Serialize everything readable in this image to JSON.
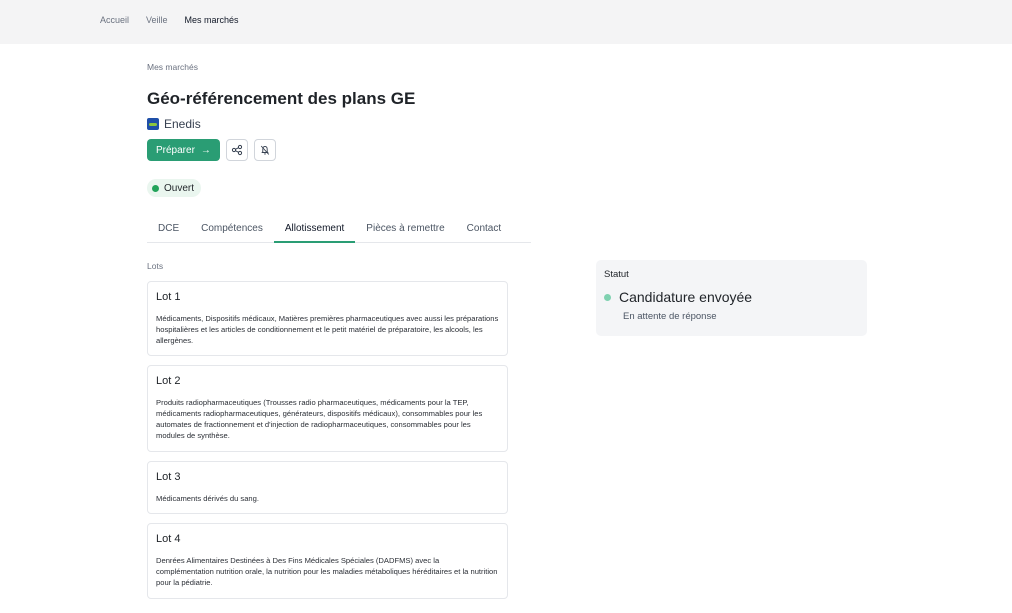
{
  "nav": {
    "items": [
      {
        "label": "Accueil"
      },
      {
        "label": "Veille"
      },
      {
        "label": "Mes marchés"
      }
    ]
  },
  "breadcrumb": "Mes marchés",
  "title": "Géo-référencement des plans GE",
  "organization": "Enedis",
  "actions": {
    "prepare_label": "Préparer",
    "prepare_arrow": "→"
  },
  "status_badge": "Ouvert",
  "tabs": [
    {
      "label": "DCE"
    },
    {
      "label": "Compétences"
    },
    {
      "label": "Allotissement"
    },
    {
      "label": "Pièces à remettre"
    },
    {
      "label": "Contact"
    }
  ],
  "lots_label": "Lots",
  "lots": [
    {
      "title": "Lot 1",
      "description": "Médicaments, Dispositifs médicaux, Matières premières pharmaceutiques avec aussi les préparations hospitalières et les articles de conditionnement et le petit matériel de préparatoire, les alcools, les allergènes."
    },
    {
      "title": "Lot 2",
      "description": "Produits radiopharmaceutiques (Trousses radio pharmaceutiques, médicaments pour la TEP, médicaments radiopharmaceutiques, générateurs, dispositifs médicaux), consommables pour les automates de fractionnement et d'injection de radiopharmaceutiques, consommables pour les modules de synthèse."
    },
    {
      "title": "Lot 3",
      "description": "Médicaments dérivés du sang."
    },
    {
      "title": "Lot 4",
      "description": "Denrées Alimentaires Destinées à Des Fins Médicales Spéciales (DADFMS) avec la complémentation nutrition orale, la nutrition pour les maladies métaboliques héréditaires et la nutrition pour la pédiatrie."
    }
  ],
  "status_card": {
    "label": "Statut",
    "value": "Candidature envoyée",
    "sub": "En attente de réponse"
  },
  "colors": {
    "accent": "#2a9d74",
    "open_dot": "#22a35a",
    "status_dot": "#7fd1b0"
  }
}
